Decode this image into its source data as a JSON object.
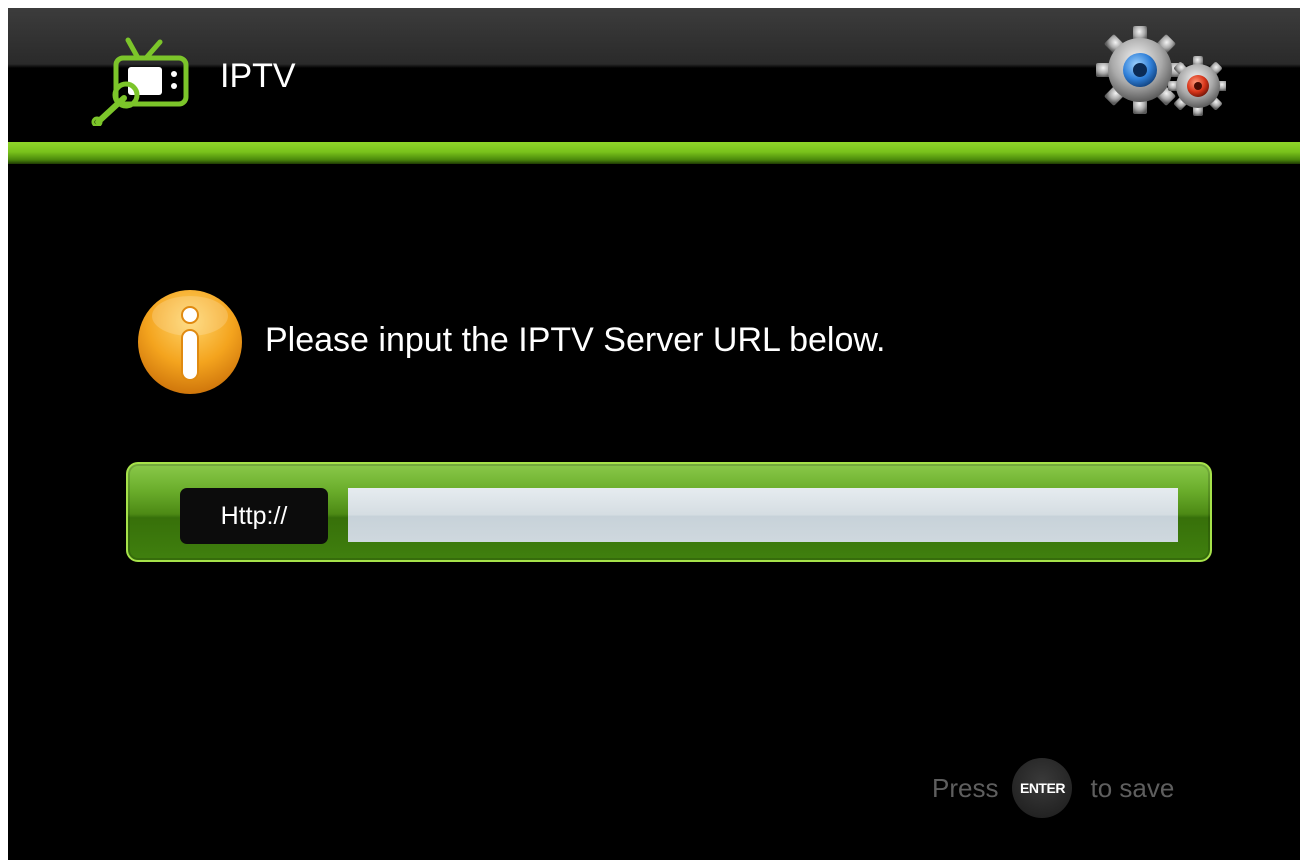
{
  "header": {
    "title": "IPTV",
    "app_icon": "tv-wrench-icon",
    "settings_icon": "gears-icon"
  },
  "main": {
    "info_icon": "info-icon",
    "prompt": "Please input the IPTV Server URL below.",
    "url_form": {
      "protocol_label": "Http://",
      "url_value": "",
      "url_placeholder": ""
    }
  },
  "footer": {
    "hint_before": "Press",
    "key_label": "ENTER",
    "hint_after": "to save"
  },
  "colors": {
    "background": "#000000",
    "accent_green": "#79c21c",
    "text_white": "#ffffff",
    "hint_gray": "#5e5e5e",
    "info_orange": "#f0a020"
  }
}
